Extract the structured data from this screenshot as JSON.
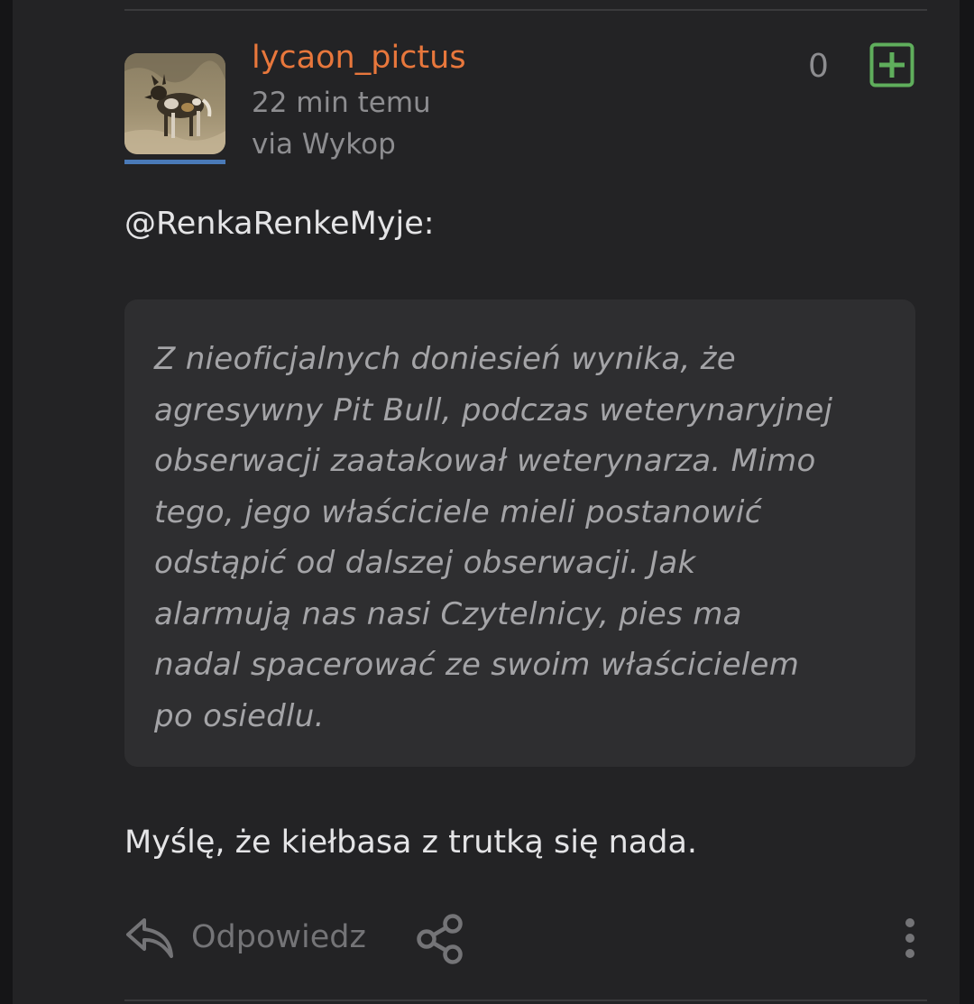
{
  "post": {
    "author": "lycaon_pictus",
    "time": "22 min temu",
    "via": "via Wykop",
    "vote_count": "0",
    "mention": "@RenkaRenkeMyje:",
    "quote_lines": [
      "Z nieoficjalnych doniesień wynika, że",
      "agresywny Pit Bull, podczas weterynaryjnej",
      "obserwacji zaatakował weterynarza. Mimo",
      "tego, jego właściciele mieli postanowić",
      "odstąpić od dalszej obserwacji. Jak",
      "alarmują nas nasi Czytelnicy, pies ma",
      "nadal spacerować ze swoim właścicielem",
      "po osiedlu."
    ],
    "body": "Myślę, że kiełbasa z trutką się nada."
  },
  "actions": {
    "reply_label": "Odpowiedz"
  },
  "icons": {
    "plus": "plus-square-icon",
    "reply": "reply-arrow-icon",
    "share": "share-icon",
    "more": "more-vertical-icon"
  },
  "colors": {
    "background": "#151517",
    "card": "#232325",
    "quote_bg": "#2e2e30",
    "username": "#e8773c",
    "plus_green": "#5fae5c",
    "avatar_bar": "#4a7ab8"
  }
}
